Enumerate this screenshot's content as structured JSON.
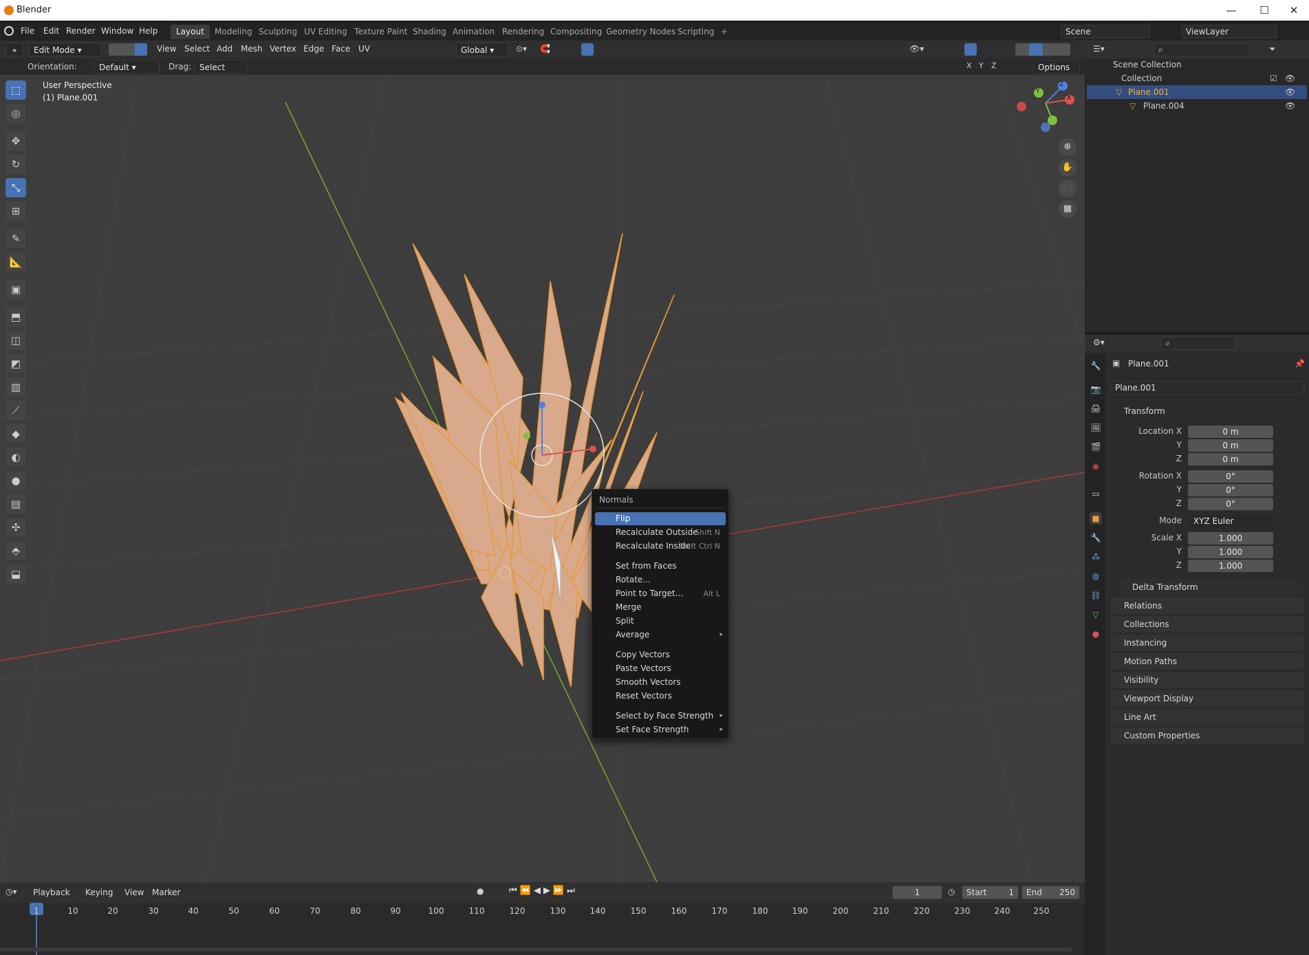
{
  "title_bar": {
    "app_name": "Blender",
    "minimize": "—",
    "maximize": "☐",
    "close": "✕"
  },
  "top_menu": [
    "File",
    "Edit",
    "Render",
    "Window",
    "Help"
  ],
  "workspace_tabs": [
    "Layout",
    "Modeling",
    "Sculpting",
    "UV Editing",
    "Texture Paint",
    "Shading",
    "Animation",
    "Rendering",
    "Compositing",
    "Geometry Nodes",
    "Scripting"
  ],
  "workspace_add": "+",
  "scene_name": "Scene",
  "view_layer": "ViewLayer",
  "header": {
    "mode": "Edit Mode",
    "menus": [
      "View",
      "Select",
      "Add",
      "Mesh",
      "Vertex",
      "Edge",
      "Face",
      "UV"
    ],
    "transform_orientation": "Global",
    "axes": [
      "X",
      "Y",
      "Z"
    ],
    "options": "Options"
  },
  "tool_settings": {
    "orientation_label": "Orientation:",
    "orientation_value": "Default",
    "drag_label": "Drag:",
    "drag_value": "Select Box"
  },
  "viewport": {
    "view_name": "User Perspective",
    "object_line": "(1) Plane.001"
  },
  "gizmo": {
    "x": "X",
    "y": "Y",
    "z": "Z"
  },
  "context_menu": {
    "title": "Normals",
    "items": [
      {
        "label": "Flip",
        "shortcut": "",
        "submenu": ""
      },
      {
        "label": "Recalculate Outside",
        "shortcut": "Shift N",
        "submenu": ""
      },
      {
        "label": "Recalculate Inside",
        "shortcut": "Shift Ctrl N",
        "submenu": ""
      },
      {
        "label": "Set from Faces",
        "shortcut": "",
        "submenu": ""
      },
      {
        "label": "Rotate...",
        "shortcut": "",
        "submenu": ""
      },
      {
        "label": "Point to Target...",
        "shortcut": "Alt L",
        "submenu": ""
      },
      {
        "label": "Merge",
        "shortcut": "",
        "submenu": ""
      },
      {
        "label": "Split",
        "shortcut": "",
        "submenu": ""
      },
      {
        "label": "Average",
        "shortcut": "",
        "submenu": "▸"
      },
      {
        "label": "Copy Vectors",
        "shortcut": "",
        "submenu": ""
      },
      {
        "label": "Paste Vectors",
        "shortcut": "",
        "submenu": ""
      },
      {
        "label": "Smooth Vectors",
        "shortcut": "",
        "submenu": ""
      },
      {
        "label": "Reset Vectors",
        "shortcut": "",
        "submenu": ""
      },
      {
        "label": "Select by Face Strength",
        "shortcut": "",
        "submenu": "▸"
      },
      {
        "label": "Set Face Strength",
        "shortcut": "",
        "submenu": "▸"
      }
    ]
  },
  "outliner": {
    "root": "Scene Collection",
    "collection": "Collection",
    "objects": [
      "Plane.001",
      "Plane.004"
    ]
  },
  "properties": {
    "object_name": "Plane.001",
    "object_field": "Plane.001",
    "transform_header": "Transform",
    "location_label": "Location X",
    "location": [
      "0 m",
      "0 m",
      "0 m"
    ],
    "rotation_label": "Rotation X",
    "rotation": [
      "0°",
      "0°",
      "0°"
    ],
    "mode_label": "Mode",
    "mode_value": "XYZ Euler",
    "scale_label": "Scale X",
    "scale": [
      "1.000",
      "1.000",
      "1.000"
    ],
    "axis_y": "Y",
    "axis_z": "Z",
    "delta_transform": "Delta Transform",
    "panels": [
      "Relations",
      "Collections",
      "Instancing",
      "Motion Paths",
      "Visibility",
      "Viewport Display",
      "Line Art",
      "Custom Properties"
    ]
  },
  "timeline": {
    "menus": [
      "Playback",
      "Keying",
      "View",
      "Marker"
    ],
    "current_frame": "1",
    "start_label": "Start",
    "start": "1",
    "end_label": "End",
    "end": "250",
    "ruler": [
      "1",
      "10",
      "20",
      "30",
      "40",
      "50",
      "60",
      "70",
      "80",
      "90",
      "100",
      "110",
      "120",
      "130",
      "140",
      "150",
      "160",
      "170",
      "180",
      "190",
      "200",
      "210",
      "220",
      "230",
      "240",
      "250"
    ]
  },
  "colors": {
    "accent": "#4772b3",
    "mesh": "#d8a98a",
    "selection": "#e89a3c",
    "viewport_bg": "#3d3d3d",
    "x_axis": "#b3343c",
    "y_axis": "#7aa82a"
  }
}
